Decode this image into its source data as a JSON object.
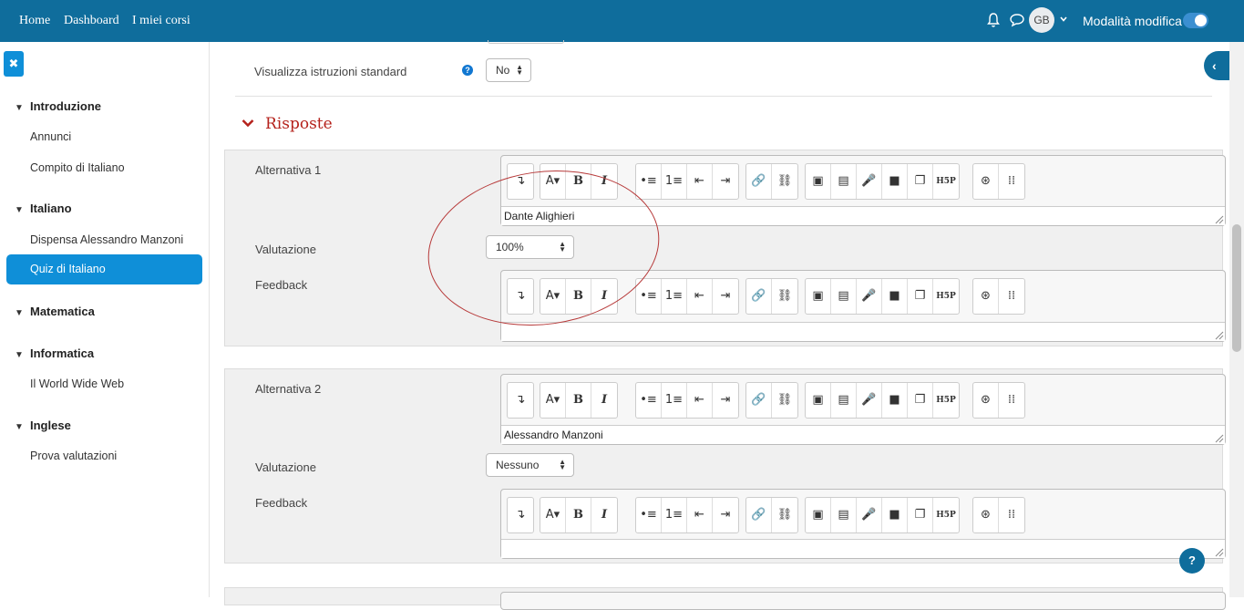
{
  "navbar": {
    "links": [
      "Home",
      "Dashboard",
      "I miei corsi"
    ],
    "avatar_initials": "GB",
    "edit_mode_label": "Modalità modifica",
    "edit_mode_on": true
  },
  "sidebar": {
    "sections": [
      {
        "title": "Introduzione",
        "items": [
          "Annunci",
          "Compito di Italiano"
        ]
      },
      {
        "title": "Italiano",
        "items": [
          "Dispensa Alessandro Manzoni",
          "Quiz di Italiano"
        ]
      },
      {
        "title": "Matematica",
        "items": []
      },
      {
        "title": "Informatica",
        "items": [
          "Il World Wide Web"
        ]
      },
      {
        "title": "Inglese",
        "items": [
          "Prova valutazioni"
        ]
      }
    ],
    "active_item": "Quiz di Italiano"
  },
  "form": {
    "standard_instructions_label": "Visualizza istruzioni standard",
    "standard_instructions_value": "No",
    "section_title": "Risposte",
    "answers": [
      {
        "label": "Alternativa 1",
        "text": "Dante Alighieri",
        "grade_label": "Valutazione",
        "grade_value": "100%",
        "feedback_label": "Feedback"
      },
      {
        "label": "Alternativa 2",
        "text": "Alessandro Manzoni",
        "grade_label": "Valutazione",
        "grade_value": "Nessuno",
        "feedback_label": "Feedback"
      }
    ]
  },
  "toolbar": {
    "bold": "B",
    "italic": "I",
    "font": "A",
    "h5p": "H5P"
  },
  "help_fab": "?",
  "colors": {
    "navbar": "#0f6d9c",
    "active": "#0f8fd8",
    "section_title": "#b5221c"
  }
}
